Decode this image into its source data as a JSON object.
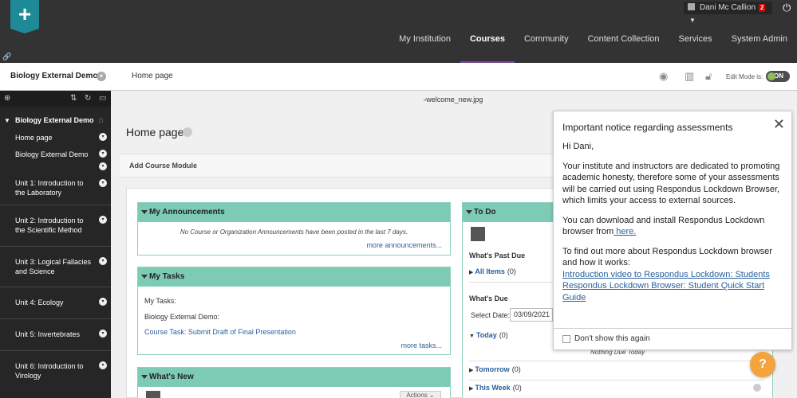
{
  "topbar": {
    "logo_glyph": "+",
    "user_name": "Dani Mc Callion",
    "notification_count": "2",
    "nav": [
      "My Institution",
      "Courses",
      "Community",
      "Content Collection",
      "Services",
      "System Admin"
    ],
    "active_nav": "Courses"
  },
  "breadcrumb": {
    "course": "Biology External Demo",
    "page": "Home page",
    "edit_mode_label": "Edit Mode is:",
    "edit_mode_value": "ON"
  },
  "sidebar": {
    "course": "Biology External Demo",
    "items": [
      "Home page",
      "Biology External Demo",
      "Unit 1: Introduction to the Laboratory",
      "Unit 2: Introduction to the Scientific Method",
      "Unit 3: Logical Fallacies and Science",
      "Unit 4: Ecology",
      "Unit 5: Invertebrates",
      "Unit 6: Introduction to Virology"
    ]
  },
  "main": {
    "welcome_image_alt": "welcome_new.jpg",
    "page_title": "Home page",
    "add_module": "Add Course Module",
    "announcements": {
      "title": "My Announcements",
      "empty": "No Course or Organization Announcements have been posted in the last 7 days.",
      "more": "more announcements..."
    },
    "tasks": {
      "title": "My Tasks",
      "label": "My Tasks:",
      "course": "Biology External Demo:",
      "task": "Course Task: Submit Draft of Final Presentation",
      "more": "more tasks..."
    },
    "whats_new": {
      "title": "What's New",
      "actions": "Actions"
    },
    "todo": {
      "title": "To Do",
      "past_due": "What's Past Due",
      "all_items": "All Items",
      "all_items_count": "(0)",
      "due": "What's Due",
      "select_date_label": "Select Date:",
      "select_date_value": "03/09/2021",
      "today": "Today",
      "today_count": "(0)",
      "nothing_due": "Nothing Due Today",
      "tomorrow": "Tomorrow",
      "tomorrow_count": "(0)",
      "this_week": "This Week",
      "this_week_count": "(0)"
    }
  },
  "notice": {
    "title": "Important notice regarding assessments",
    "greeting": "Hi Dani,",
    "para1": "Your institute and instructors are dedicated to promoting academic honesty, therefore some of your assessments will be carried out using Respondus Lockdown Browser, which limits your access to external sources.",
    "para2_prefix": "You can download and install Respondus Lockdown browser from",
    "para2_link": " here.",
    "para3": "To find out more about Respondus Lockdown browser and how it works:",
    "link1": "Introduction video to Respondus Lockdown: Students",
    "link2": "Respondus Lockdown Browser: Student Quick Start Guide",
    "dont_show": "Don't show this again"
  },
  "colors": {
    "module_header": "#7ecbb5",
    "topbar": "#333333",
    "help_button": "#f5a33c"
  }
}
